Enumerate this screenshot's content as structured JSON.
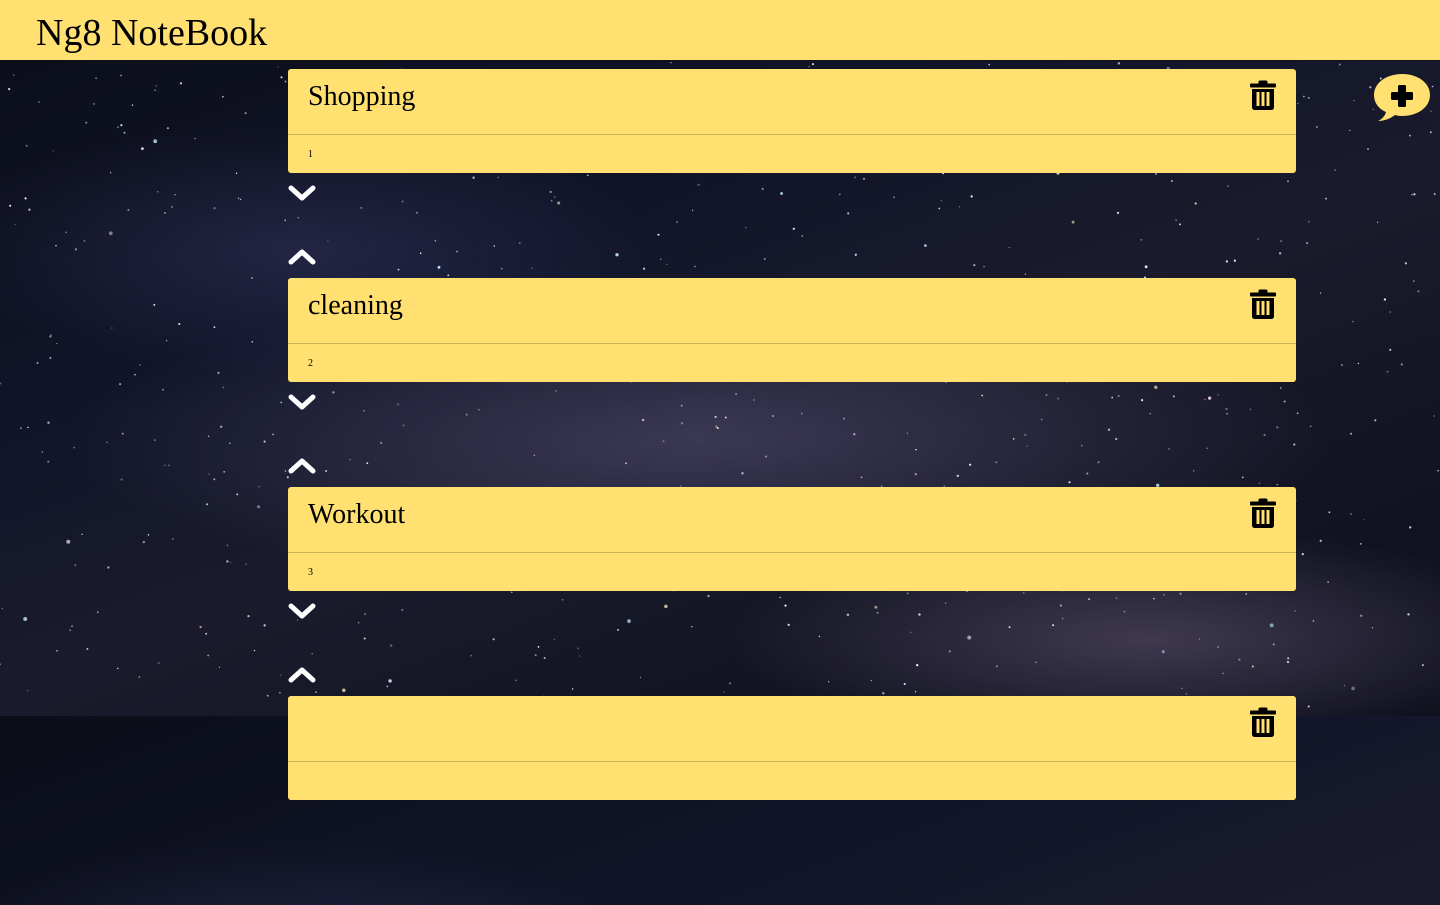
{
  "header": {
    "title": "Ng8 NoteBook"
  },
  "notes": [
    {
      "title": "Shopping",
      "content": "1"
    },
    {
      "title": "cleaning",
      "content": "2"
    },
    {
      "title": "Workout",
      "content": "3"
    },
    {
      "title": "",
      "content": ""
    }
  ],
  "icons": {
    "add": "comment-plus-icon",
    "delete": "trash-icon",
    "move_down": "chevron-down-icon",
    "move_up": "chevron-up-icon"
  },
  "colors": {
    "accent": "#ffe070",
    "background": "#0b0d18"
  }
}
